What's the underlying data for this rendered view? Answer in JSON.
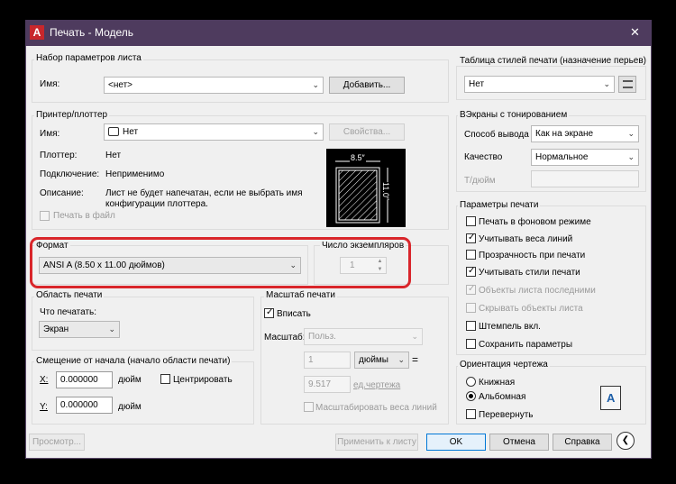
{
  "window": {
    "title": "Печать - Модель",
    "close_glyph": "✕"
  },
  "page_setup": {
    "group": "Набор параметров листа",
    "name_label": "Имя:",
    "name_value": "<нет>",
    "add_button": "Добавить..."
  },
  "plotter": {
    "group": "Принтер/плоттер",
    "name_label": "Имя:",
    "name_value": "Нет",
    "properties_button": "Свойства...",
    "plotter_label": "Плоттер:",
    "plotter_value": "Нет",
    "connection_label": "Подключение:",
    "connection_value": "Неприменимо",
    "description_label": "Описание:",
    "description_value_1": "Лист не будет напечатан, если не выбрать имя",
    "description_value_2": "конфигурации плоттера.",
    "print_to_file": "Печать в файл",
    "preview_width": "8.5″",
    "preview_height": "11.0″"
  },
  "paper_size": {
    "group": "Формат",
    "value": "ANSI A (8.50 x 11.00 дюймов)"
  },
  "copies": {
    "group": "Число экземпляров",
    "value": "1"
  },
  "plot_area": {
    "group": "Область печати",
    "what_label": "Что печатать:",
    "what_value": "Экран"
  },
  "plot_offset": {
    "group": "Смещение от начала (начало области печати)",
    "x_label": "X:",
    "x_value": "0.000000",
    "x_unit": "дюйм",
    "y_label": "Y:",
    "y_value": "0.000000",
    "y_unit": "дюйм",
    "center_label": "Центрировать"
  },
  "plot_scale": {
    "group": "Масштаб печати",
    "fit_label": "Вписать",
    "scale_label": "Масштаб:",
    "scale_value": "Польз.",
    "value_1": "1",
    "unit_value": "дюймы",
    "equals": "=",
    "value_2": "9.517",
    "unit_2": "ед.чертежа",
    "lineweights_label": "Масштабировать веса линий"
  },
  "plot_style": {
    "group": "Таблица стилей печати (назначение перьев)",
    "value": "Нет"
  },
  "shaded": {
    "group": "ВЭкраны с тонированием",
    "output_label": "Способ вывода",
    "output_value": "Как на экране",
    "quality_label": "Качество",
    "quality_value": "Нормальное",
    "dpi_label": "Т/дюйм"
  },
  "options": {
    "group": "Параметры печати",
    "items": [
      {
        "label": "Печать в фоновом режиме",
        "checked": false,
        "disabled": false
      },
      {
        "label": "Учитывать веса линий",
        "checked": true,
        "disabled": false
      },
      {
        "label": "Прозрачность при печати",
        "checked": false,
        "disabled": false
      },
      {
        "label": "Учитывать стили печати",
        "checked": true,
        "disabled": false
      },
      {
        "label": "Объекты листа последними",
        "checked": true,
        "disabled": true
      },
      {
        "label": "Скрывать объекты листа",
        "checked": false,
        "disabled": true
      },
      {
        "label": "Штемпель вкл.",
        "checked": false,
        "disabled": false
      },
      {
        "label": "Сохранить параметры",
        "checked": false,
        "disabled": false
      }
    ]
  },
  "orientation": {
    "group": "Ориентация чертежа",
    "portrait": "Книжная",
    "landscape": "Альбомная",
    "upside_down": "Перевернуть",
    "icon_letter": "A"
  },
  "footer": {
    "preview": "Просмотр...",
    "apply": "Применить к листу",
    "ok": "OK",
    "cancel": "Отмена",
    "help": "Справка"
  },
  "colors": {
    "title_bar": "#4e3b5e",
    "highlight": "#d9262b",
    "app_logo": "#c8272c"
  }
}
